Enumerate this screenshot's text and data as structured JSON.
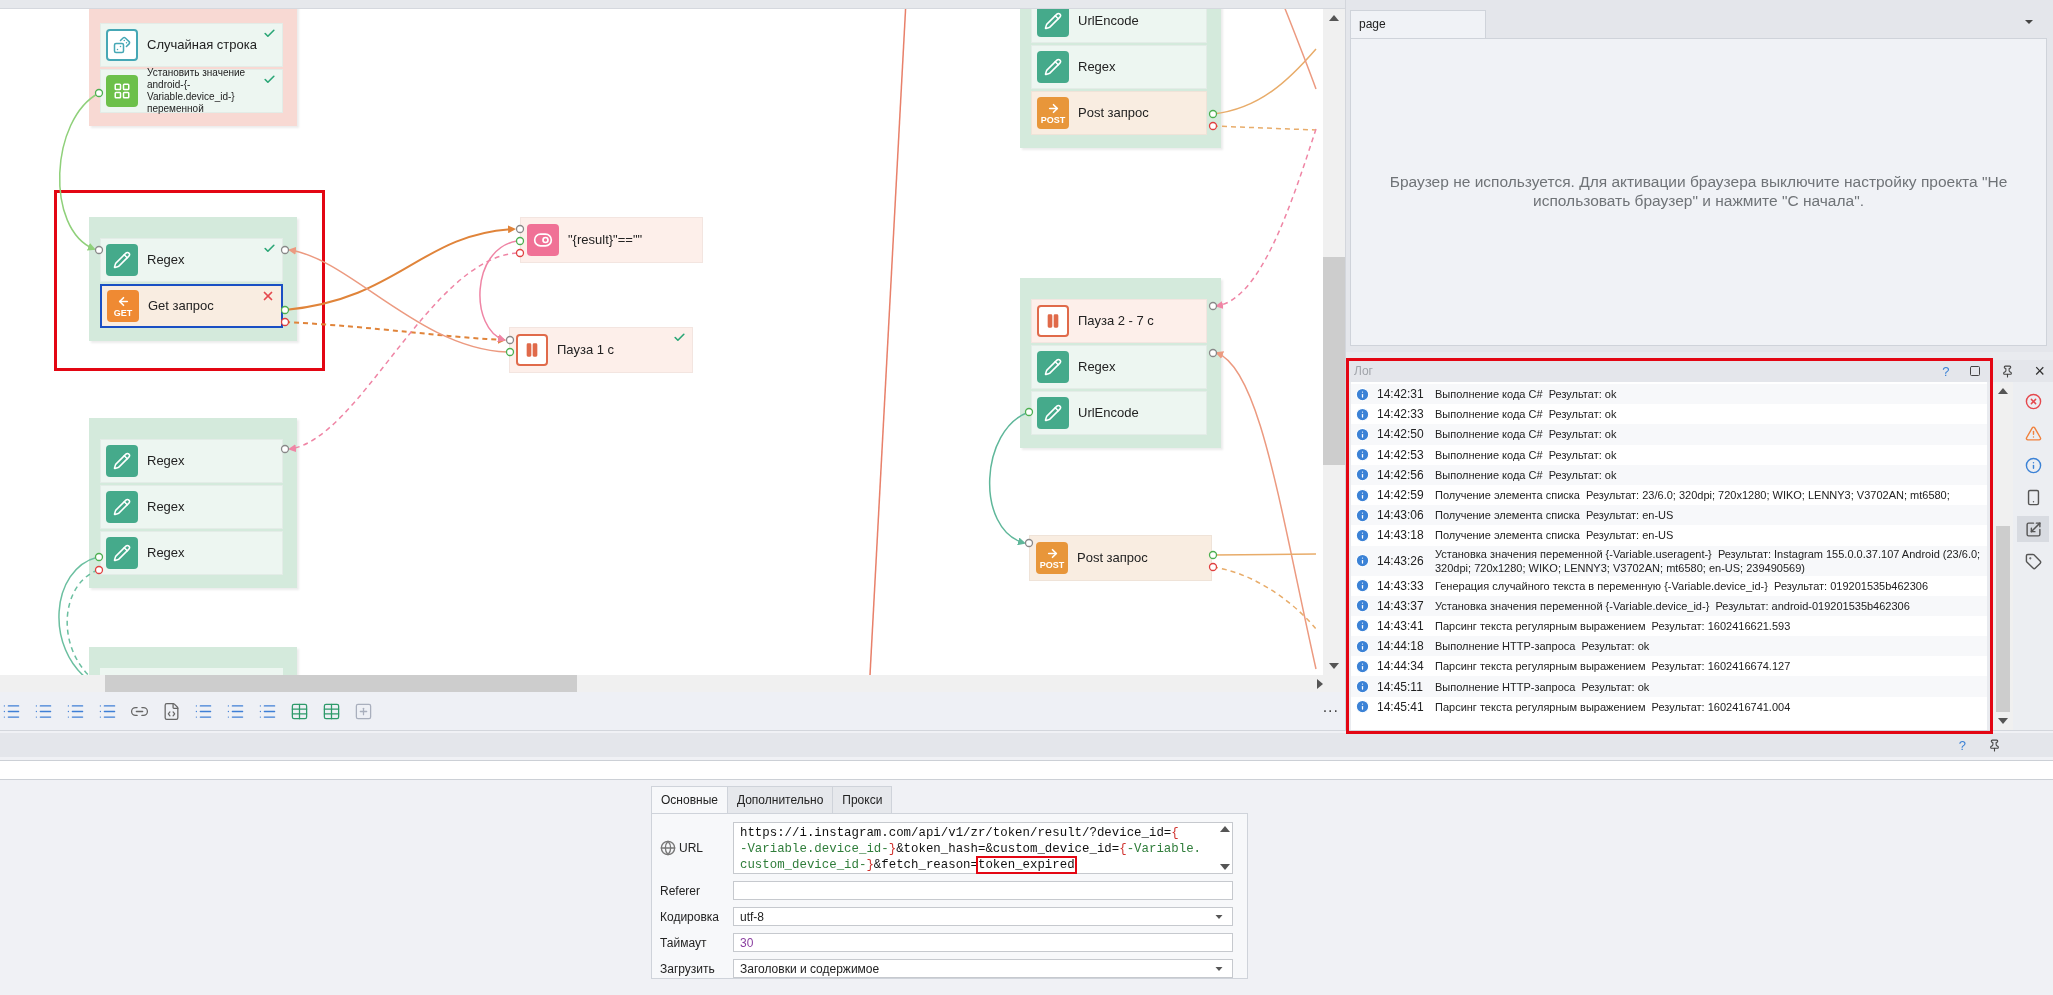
{
  "canvas": {
    "nodes": [
      {
        "kind": "group",
        "color": "#f8d9d3",
        "items": [
          {
            "label": "Случайная строка",
            "kind": "dice",
            "done": true,
            "selected": false
          },
          {
            "label": "Установить значение android-{-Variable.device_id-} переменной",
            "kind": "grid",
            "done": true,
            "selected": false,
            "small": true
          }
        ]
      },
      {
        "kind": "group",
        "color": "#d4eadc",
        "outlined": true,
        "items": [
          {
            "label": "Regex",
            "kind": "pencil",
            "done": true,
            "selected": false
          },
          {
            "label": "Get запрос",
            "kind": "get",
            "badge": "GET",
            "failed": true,
            "selected": true
          }
        ]
      },
      {
        "kind": "block",
        "item": {
          "label": "\"{result}\"==\"\"",
          "kind": "toggle",
          "selected": false
        }
      },
      {
        "kind": "block",
        "item": {
          "label": "Пауза 1 с",
          "kind": "pause",
          "done": true,
          "selected": false
        }
      },
      {
        "kind": "group",
        "color": "#d4eadc",
        "items": [
          {
            "label": "Regex",
            "kind": "pencil",
            "selected": false
          },
          {
            "label": "Regex",
            "kind": "pencil",
            "selected": false
          },
          {
            "label": "Regex",
            "kind": "pencil",
            "selected": false
          }
        ]
      },
      {
        "kind": "group",
        "color": "#d4eadc"
      },
      {
        "kind": "group",
        "color": "#d4eadc",
        "items": [
          {
            "label": "UrlEncode",
            "kind": "pencil",
            "selected": false
          },
          {
            "label": "Regex",
            "kind": "pencil",
            "selected": false
          },
          {
            "label": "Post запрос",
            "kind": "post",
            "badge": "POST",
            "selected": false
          }
        ]
      },
      {
        "kind": "group",
        "color": "#d4eadc",
        "items": [
          {
            "label": "Пауза 2 - 7 с",
            "kind": "pause",
            "selected": false
          },
          {
            "label": "Regex",
            "kind": "pencil",
            "selected": false
          },
          {
            "label": "UrlEncode",
            "kind": "pencil",
            "selected": false
          }
        ]
      },
      {
        "kind": "block",
        "item": {
          "label": "Post запрос",
          "kind": "post",
          "badge": "POST",
          "selected": false
        }
      }
    ],
    "tools": [
      {
        "kind": "list"
      },
      {
        "kind": "list"
      },
      {
        "kind": "list"
      },
      {
        "kind": "list"
      },
      {
        "kind": "link"
      },
      {
        "kind": "code"
      },
      {
        "kind": "list"
      },
      {
        "kind": "list"
      },
      {
        "kind": "list"
      },
      {
        "kind": "table"
      },
      {
        "kind": "table"
      },
      {
        "kind": "add"
      }
    ],
    "more": "..."
  },
  "browser": {
    "tabs": [
      {
        "label": "page",
        "selected": true
      }
    ],
    "message": "Браузер не используется. Для активации браузера выключите настройку проекта \"Не использовать браузер\" и нажмите \"С начала\"."
  },
  "log": {
    "title": "Лог",
    "help": "?",
    "close": "×",
    "outlined": true,
    "entries": [
      {
        "kind": "info",
        "time": "14:42:31",
        "text": "Выполнение кода C#  Результат: ok"
      },
      {
        "kind": "info",
        "time": "14:42:33",
        "text": "Выполнение кода C#  Результат: ok"
      },
      {
        "kind": "info",
        "time": "14:42:50",
        "text": "Выполнение кода C#  Результат: ok"
      },
      {
        "kind": "info",
        "time": "14:42:53",
        "text": "Выполнение кода C#  Результат: ok"
      },
      {
        "kind": "info",
        "time": "14:42:56",
        "text": "Выполнение кода C#  Результат: ok"
      },
      {
        "kind": "info",
        "time": "14:42:59",
        "text": "Получение элемента списка  Результат: 23/6.0; 320dpi; 720x1280; WIKO; LENNY3; V3702AN; mt6580;"
      },
      {
        "kind": "info",
        "time": "14:43:06",
        "text": "Получение элемента списка  Результат: en-US"
      },
      {
        "kind": "info",
        "time": "14:43:18",
        "text": "Получение элемента списка  Результат: en-US"
      },
      {
        "kind": "info",
        "time": "14:43:26",
        "text": "Установка значения переменной {-Variable.useragent-}  Результат: Instagram 155.0.0.37.107 Android (23/6.0; 320dpi; 720x1280; WIKO; LENNY3; V3702AN; mt6580; en-US; 239490569)"
      },
      {
        "kind": "info",
        "time": "14:43:33",
        "text": "Генерация случайного текста в переменную {-Variable.device_id-}  Результат: 019201535b462306"
      },
      {
        "kind": "info",
        "time": "14:43:37",
        "text": "Установка значения переменной {-Variable.device_id-}  Результат: android-019201535b462306"
      },
      {
        "kind": "info",
        "time": "14:43:41",
        "text": "Парсинг текста регулярным выражением  Результат: 1602416621.593"
      },
      {
        "kind": "info",
        "time": "14:44:18",
        "text": "Выполнение HTTP-запроса  Результат: ok"
      },
      {
        "kind": "info",
        "time": "14:44:34",
        "text": "Парсинг текста регулярным выражением  Результат: 1602416674.127"
      },
      {
        "kind": "info",
        "time": "14:45:11",
        "text": "Выполнение HTTP-запроса  Результат: ok"
      },
      {
        "kind": "info",
        "time": "14:45:41",
        "text": "Парсинг текста регулярным выражением  Результат: 1602416741.004"
      }
    ],
    "filters": [
      {
        "kind": "error",
        "selected": false
      },
      {
        "kind": "warning",
        "selected": false
      },
      {
        "kind": "info",
        "selected": false
      },
      {
        "kind": "device",
        "selected": false
      },
      {
        "kind": "expand",
        "selected": true
      },
      {
        "kind": "tag",
        "selected": false
      }
    ]
  },
  "properties": {
    "help": "?",
    "tabs": [
      {
        "label": "Основные",
        "selected": true
      },
      {
        "label": "Дополнительно",
        "selected": false
      },
      {
        "label": "Прокси",
        "selected": false
      }
    ],
    "fields": [
      {
        "kind": "url",
        "label": "URL",
        "lines": [
          [
            {
              "kind": "plain",
              "text": "https://i.instagram.com/api/v1/zr/token/result/?device_id="
            },
            {
              "kind": "brace",
              "text": "{"
            }
          ],
          [
            {
              "kind": "variable",
              "text": "-Variable.device_id-"
            },
            {
              "kind": "brace",
              "text": "}"
            },
            {
              "kind": "plain",
              "text": "&token_hash=&custom_device_id="
            },
            {
              "kind": "brace",
              "text": "{"
            },
            {
              "kind": "variable",
              "text": "-Variable."
            }
          ],
          [
            {
              "kind": "variable",
              "text": "custom_device_id-"
            },
            {
              "kind": "brace",
              "text": "}"
            },
            {
              "kind": "plain",
              "text": "&fetch_reason="
            },
            {
              "kind": "marked",
              "text": "token_expired"
            }
          ]
        ]
      },
      {
        "kind": "text",
        "label": "Referer"
      },
      {
        "kind": "select",
        "label": "Кодировка",
        "value": "utf-8"
      },
      {
        "kind": "number",
        "label": "Таймаут",
        "value": "30"
      },
      {
        "kind": "select",
        "label": "Загрузить",
        "value": "Заголовки и содержимое"
      }
    ]
  }
}
